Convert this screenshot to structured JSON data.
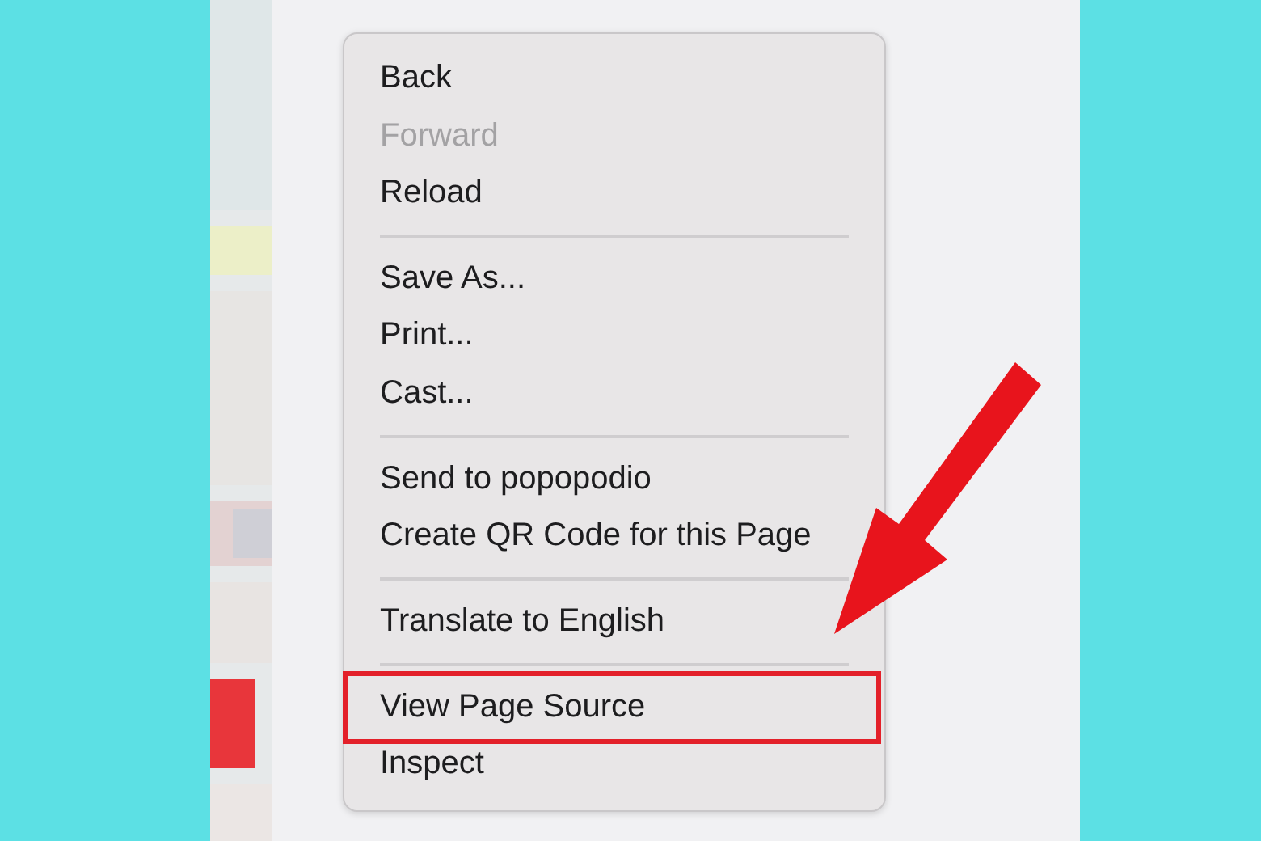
{
  "context_menu": {
    "items": [
      {
        "kind": "item",
        "label": "Back",
        "disabled": false,
        "highlighted": false
      },
      {
        "kind": "item",
        "label": "Forward",
        "disabled": true,
        "highlighted": false
      },
      {
        "kind": "item",
        "label": "Reload",
        "disabled": false,
        "highlighted": false
      },
      {
        "kind": "separator"
      },
      {
        "kind": "item",
        "label": "Save As...",
        "disabled": false,
        "highlighted": false
      },
      {
        "kind": "item",
        "label": "Print...",
        "disabled": false,
        "highlighted": false
      },
      {
        "kind": "item",
        "label": "Cast...",
        "disabled": false,
        "highlighted": false
      },
      {
        "kind": "separator"
      },
      {
        "kind": "item",
        "label": "Send to popopodio",
        "disabled": false,
        "highlighted": false
      },
      {
        "kind": "item",
        "label": "Create QR Code for this Page",
        "disabled": false,
        "highlighted": false
      },
      {
        "kind": "separator"
      },
      {
        "kind": "item",
        "label": "Translate to English",
        "disabled": false,
        "highlighted": false
      },
      {
        "kind": "separator"
      },
      {
        "kind": "item",
        "label": "View Page Source",
        "disabled": false,
        "highlighted": true
      },
      {
        "kind": "item",
        "label": "Inspect",
        "disabled": false,
        "highlighted": false
      }
    ]
  }
}
